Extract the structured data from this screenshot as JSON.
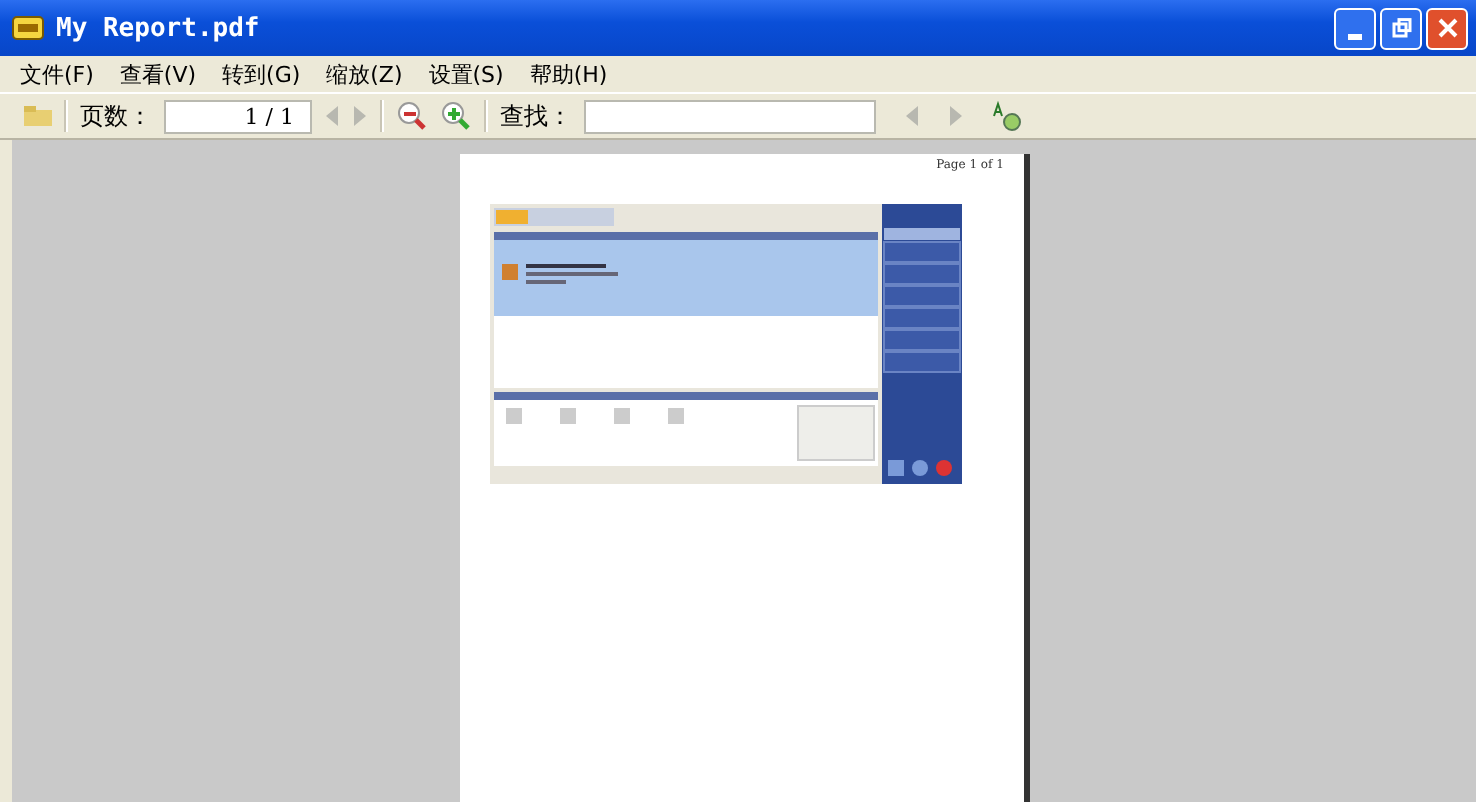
{
  "window": {
    "title": "My Report.pdf"
  },
  "menu": [
    "文件(F)",
    "查看(V)",
    "转到(G)",
    "缩放(Z)",
    "设置(S)",
    "帮助(H)"
  ],
  "toolbar": {
    "page_label": "页数：",
    "page_value": "1 / 1",
    "find_label": "查找："
  },
  "document": {
    "header": "Page 1 of 1"
  }
}
